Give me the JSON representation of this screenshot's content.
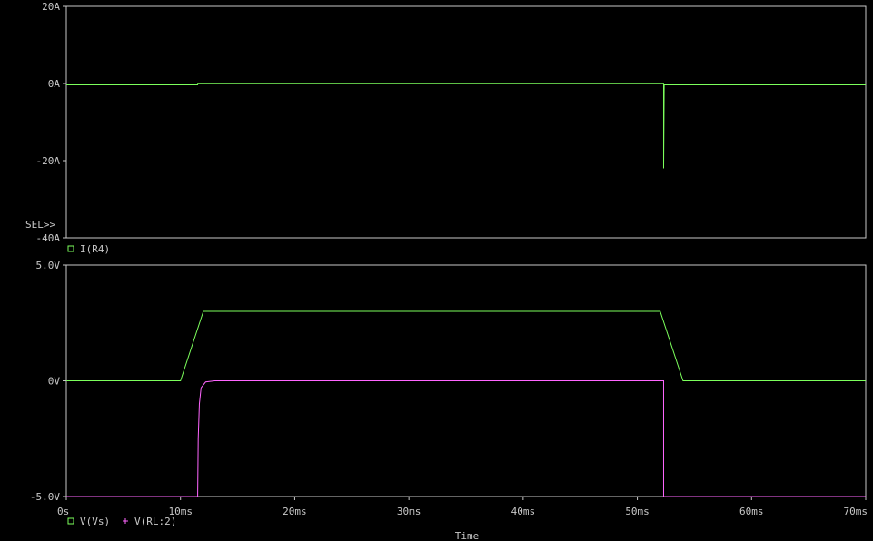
{
  "colors": {
    "background": "#000000",
    "frame": "#c8c8c8",
    "text": "#c8c8c8",
    "green": "#7cff5c",
    "magenta": "#ff66ff"
  },
  "x_axis_label": "Time",
  "sel_label": "SEL>>",
  "chart_data": [
    {
      "type": "line",
      "x_unit": "ms",
      "xlim": [
        0,
        70
      ],
      "ylim": [
        -40,
        20
      ],
      "y_ticks": [
        {
          "value": 20,
          "label": "20A"
        },
        {
          "value": 0,
          "label": "0A"
        },
        {
          "value": -20,
          "label": "-20A"
        },
        {
          "value": -40,
          "label": "-40A"
        }
      ],
      "legend": [
        {
          "marker": "square",
          "label": "I(R4)",
          "color": "#7cff5c"
        }
      ],
      "series": [
        {
          "name": "I(R4)",
          "color": "#7cff5c",
          "points": [
            [
              0,
              -0.35
            ],
            [
              11.5,
              -0.35
            ],
            [
              11.5,
              0.05
            ],
            [
              52.3,
              0.05
            ],
            [
              52.3,
              -22
            ],
            [
              52.35,
              -0.35
            ],
            [
              70,
              -0.35
            ]
          ]
        }
      ]
    },
    {
      "type": "line",
      "x_unit": "ms",
      "xlim": [
        0,
        70
      ],
      "ylim": [
        -5,
        5
      ],
      "y_ticks": [
        {
          "value": 5,
          "label": "5.0V"
        },
        {
          "value": 0,
          "label": "0V"
        },
        {
          "value": -5,
          "label": "-5.0V"
        }
      ],
      "x_ticks": [
        {
          "value": 0,
          "label": "0s"
        },
        {
          "value": 10,
          "label": "10ms"
        },
        {
          "value": 20,
          "label": "20ms"
        },
        {
          "value": 30,
          "label": "30ms"
        },
        {
          "value": 40,
          "label": "40ms"
        },
        {
          "value": 50,
          "label": "50ms"
        },
        {
          "value": 60,
          "label": "60ms"
        },
        {
          "value": 70,
          "label": "70ms"
        }
      ],
      "legend": [
        {
          "marker": "square",
          "label": "V(Vs)",
          "color": "#7cff5c"
        },
        {
          "marker": "plus",
          "label": "V(RL:2)",
          "color": "#ff66ff"
        }
      ],
      "series": [
        {
          "name": "V(Vs)",
          "color": "#7cff5c",
          "points": [
            [
              0,
              0
            ],
            [
              10,
              0
            ],
            [
              12,
              3
            ],
            [
              52,
              3
            ],
            [
              54,
              0
            ],
            [
              70,
              0
            ]
          ]
        },
        {
          "name": "V(RL:2)",
          "color": "#ff66ff",
          "points": [
            [
              0,
              -5
            ],
            [
              11.5,
              -5
            ],
            [
              11.55,
              -2.5
            ],
            [
              11.65,
              -1.0
            ],
            [
              11.8,
              -0.3
            ],
            [
              12.2,
              -0.05
            ],
            [
              13,
              0
            ],
            [
              52.3,
              0
            ],
            [
              52.3,
              -5
            ],
            [
              70,
              -5
            ]
          ]
        }
      ]
    }
  ]
}
